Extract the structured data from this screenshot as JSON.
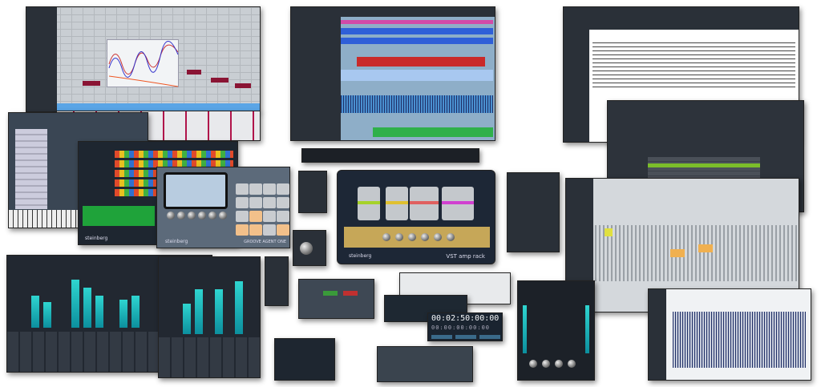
{
  "collage": {
    "brand": "steinberg",
    "amp_rack": {
      "title": "VST amp rack",
      "brand": "steinberg"
    },
    "groove_agent": {
      "title": "GROOVE AGENT ONE",
      "brand": "steinberg"
    },
    "halion": {
      "brand": "steinberg"
    },
    "beat_designer": {
      "brand": "steinberg"
    },
    "transport": {
      "timecode_primary": "00:02:50:00:00",
      "timecode_secondary": "00:00:00:00:00"
    }
  },
  "colors": {
    "meter": "#2fd5d0",
    "panel_dark": "#2a3038",
    "editor_light": "#c9ced3",
    "amp_gold": "#c6a758"
  }
}
